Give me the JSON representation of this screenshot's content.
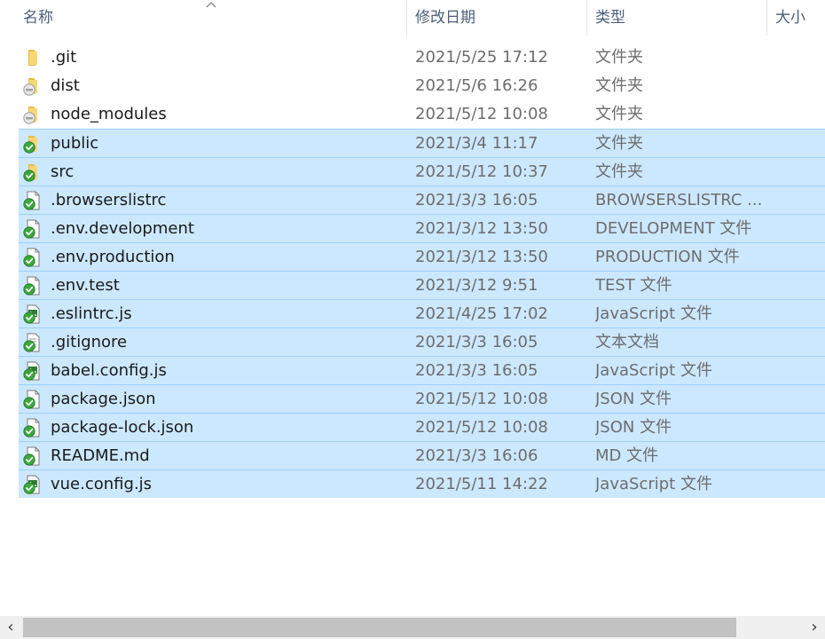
{
  "columns": {
    "name": "名称",
    "date": "修改日期",
    "type": "类型",
    "size": "大小"
  },
  "sort": {
    "column": "name",
    "direction": "ascending",
    "icon": "sort-up-chevron"
  },
  "colors": {
    "selection_bg": "#cce8ff",
    "selection_border": "#99d1ff",
    "folder": "#f8d775",
    "sync_ok": "#3aa83a",
    "sync_pending": "#a0a0a0"
  },
  "files": [
    {
      "name": ".git",
      "date": "2021/5/25 17:12",
      "type": "文件夹",
      "icon": "folder",
      "overlay": "none",
      "selected": false
    },
    {
      "name": "dist",
      "date": "2021/5/6 16:26",
      "type": "文件夹",
      "icon": "folder",
      "overlay": "ignored",
      "selected": false
    },
    {
      "name": "node_modules",
      "date": "2021/5/12 10:08",
      "type": "文件夹",
      "icon": "folder",
      "overlay": "ignored",
      "selected": false
    },
    {
      "name": "public",
      "date": "2021/3/4 11:17",
      "type": "文件夹",
      "icon": "folder",
      "overlay": "ok",
      "selected": true
    },
    {
      "name": "src",
      "date": "2021/5/12 10:37",
      "type": "文件夹",
      "icon": "folder",
      "overlay": "ok",
      "selected": true
    },
    {
      "name": ".browserslistrc",
      "date": "2021/3/3 16:05",
      "type": "BROWSERSLISTRC ...",
      "icon": "file",
      "overlay": "ok",
      "selected": true
    },
    {
      "name": ".env.development",
      "date": "2021/3/12 13:50",
      "type": "DEVELOPMENT 文件",
      "icon": "file",
      "overlay": "ok",
      "selected": true
    },
    {
      "name": ".env.production",
      "date": "2021/3/12 13:50",
      "type": "PRODUCTION 文件",
      "icon": "file",
      "overlay": "ok",
      "selected": true
    },
    {
      "name": ".env.test",
      "date": "2021/3/12 9:51",
      "type": "TEST 文件",
      "icon": "file",
      "overlay": "ok",
      "selected": true
    },
    {
      "name": ".eslintrc.js",
      "date": "2021/4/25 17:02",
      "type": "JavaScript 文件",
      "icon": "script",
      "overlay": "ok",
      "selected": true
    },
    {
      "name": ".gitignore",
      "date": "2021/3/3 16:05",
      "type": "文本文档",
      "icon": "text",
      "overlay": "ok",
      "selected": true
    },
    {
      "name": "babel.config.js",
      "date": "2021/3/3 16:05",
      "type": "JavaScript 文件",
      "icon": "script",
      "overlay": "ok",
      "selected": true
    },
    {
      "name": "package.json",
      "date": "2021/5/12 10:08",
      "type": "JSON 文件",
      "icon": "file",
      "overlay": "ok",
      "selected": true
    },
    {
      "name": "package-lock.json",
      "date": "2021/5/12 10:08",
      "type": "JSON 文件",
      "icon": "file",
      "overlay": "ok",
      "selected": true
    },
    {
      "name": "README.md",
      "date": "2021/3/3 16:06",
      "type": "MD 文件",
      "icon": "file",
      "overlay": "ok",
      "selected": true
    },
    {
      "name": "vue.config.js",
      "date": "2021/5/11 14:22",
      "type": "JavaScript 文件",
      "icon": "script",
      "overlay": "ok",
      "selected": true
    }
  ],
  "scrollbar": {
    "left_arrow": "‹",
    "right_arrow": "›"
  }
}
